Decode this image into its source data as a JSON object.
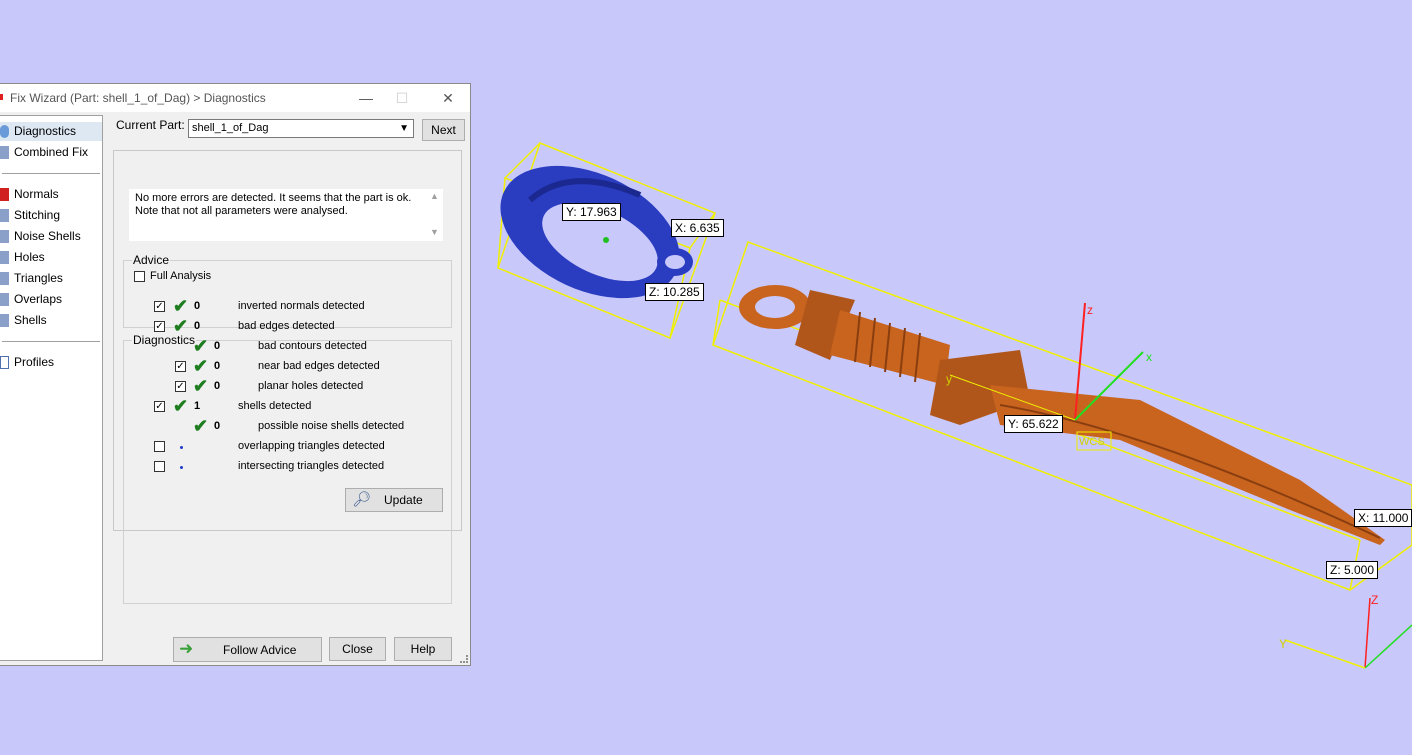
{
  "dialog": {
    "title": "Fix Wizard (Part: shell_1_of_Dag) > Diagnostics",
    "minimize": "—",
    "maximize": "☐",
    "close": "✕"
  },
  "sidebar": {
    "items": [
      {
        "label": "Diagnostics",
        "icon": "diagnostics-icon"
      },
      {
        "label": "Combined Fix",
        "icon": "combined-fix-icon"
      },
      {
        "label": "Normals",
        "icon": "normals-icon"
      },
      {
        "label": "Stitching",
        "icon": "stitching-icon"
      },
      {
        "label": "Noise Shells",
        "icon": "noise-shells-icon"
      },
      {
        "label": "Holes",
        "icon": "holes-icon"
      },
      {
        "label": "Triangles",
        "icon": "triangles-icon"
      },
      {
        "label": "Overlaps",
        "icon": "overlaps-icon"
      },
      {
        "label": "Shells",
        "icon": "shells-icon"
      },
      {
        "label": "Profiles",
        "icon": "profiles-icon"
      }
    ]
  },
  "current_part": {
    "label": "Current Part:",
    "value": "shell_1_of_Dag",
    "next": "Next"
  },
  "advice": {
    "title": "Advice",
    "text": "No more errors are detected. It seems that the part is ok. Note that not all parameters were analysed."
  },
  "diagnostics": {
    "title": "Diagnostics",
    "full_analysis": "Full Analysis",
    "rows": [
      {
        "checked": true,
        "status": "ok",
        "count": "0",
        "label": "inverted normals detected"
      },
      {
        "checked": true,
        "status": "ok",
        "count": "0",
        "label": "bad edges detected"
      },
      {
        "checked": null,
        "status": "ok",
        "count": "0",
        "label": "bad contours detected"
      },
      {
        "checked": true,
        "status": "ok",
        "count": "0",
        "label": "near bad edges detected"
      },
      {
        "checked": true,
        "status": "ok",
        "count": "0",
        "label": "planar holes detected"
      },
      {
        "checked": true,
        "status": "ok",
        "count": "1",
        "label": "shells detected"
      },
      {
        "checked": null,
        "status": "ok",
        "count": "0",
        "label": "possible noise shells detected"
      },
      {
        "checked": false,
        "status": "none",
        "count": "",
        "label": "overlapping triangles detected"
      },
      {
        "checked": false,
        "status": "none",
        "count": "",
        "label": "intersecting triangles detected"
      }
    ],
    "update": "Update"
  },
  "buttons": {
    "follow_advice": "Follow Advice",
    "close": "Close",
    "help": "Help"
  },
  "viewport": {
    "ring_dims": {
      "y": "Y: 17.963",
      "x": "X: 6.635",
      "z": "Z: 10.285"
    },
    "dagger_dims": {
      "y": "Y: 65.622",
      "x": "X: 11.000",
      "z": "Z: 5.000"
    },
    "axis_labels": {
      "x": "x",
      "y": "y",
      "z": "z",
      "wcs": "WCS"
    },
    "corner_axis": {
      "z": "Z",
      "y": "Y"
    },
    "colors": {
      "background": "#c8c8fa",
      "ring": "#2a3cc0",
      "dagger": "#c8641e",
      "bbox": "#f0f000"
    }
  }
}
